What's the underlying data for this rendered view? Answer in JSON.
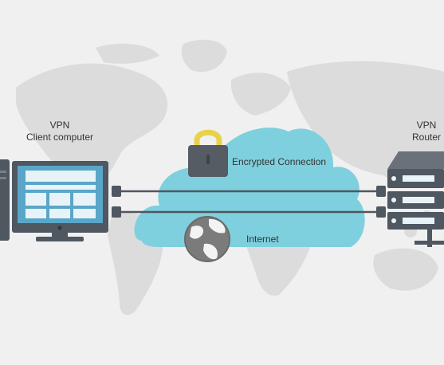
{
  "client": {
    "line1": "VPN",
    "line2": "Client computer"
  },
  "router": {
    "line1": "VPN",
    "line2": "Router"
  },
  "connection": {
    "label": "Encrypted Connection"
  },
  "internet": {
    "label": "Internet"
  },
  "colors": {
    "background": "#f0f0f0",
    "map": "#dcdcdc",
    "device": "#4f5761",
    "screen": "#5aa6c8",
    "cloud": "#7fd0de",
    "lock_shackle": "#e8d247",
    "lock_body": "#555c64",
    "globe": "#7b7b7b"
  }
}
